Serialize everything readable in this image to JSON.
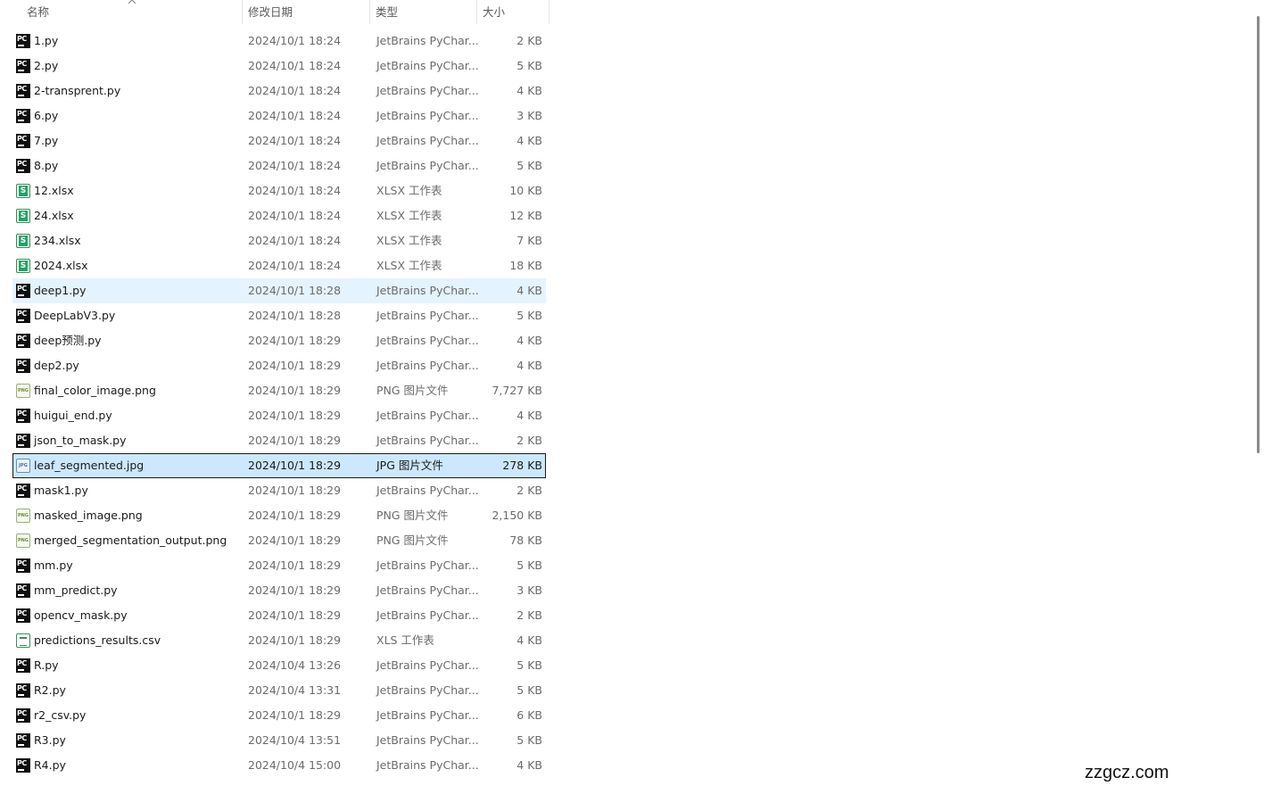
{
  "columns": {
    "name": "名称",
    "date": "修改日期",
    "type": "类型",
    "size": "大小"
  },
  "files": [
    {
      "name": "1.py",
      "date": "2024/10/1 18:24",
      "type": "JetBrains PyChar...",
      "size": "2 KB",
      "icon": "pycharm-icon"
    },
    {
      "name": "2.py",
      "date": "2024/10/1 18:24",
      "type": "JetBrains PyChar...",
      "size": "5 KB",
      "icon": "pycharm-icon"
    },
    {
      "name": "2-transprent.py",
      "date": "2024/10/1 18:24",
      "type": "JetBrains PyChar...",
      "size": "4 KB",
      "icon": "pycharm-icon"
    },
    {
      "name": "6.py",
      "date": "2024/10/1 18:24",
      "type": "JetBrains PyChar...",
      "size": "3 KB",
      "icon": "pycharm-icon"
    },
    {
      "name": "7.py",
      "date": "2024/10/1 18:24",
      "type": "JetBrains PyChar...",
      "size": "4 KB",
      "icon": "pycharm-icon"
    },
    {
      "name": "8.py",
      "date": "2024/10/1 18:24",
      "type": "JetBrains PyChar...",
      "size": "5 KB",
      "icon": "pycharm-icon"
    },
    {
      "name": "12.xlsx",
      "date": "2024/10/1 18:24",
      "type": "XLSX 工作表",
      "size": "10 KB",
      "icon": "spreadsheet-icon"
    },
    {
      "name": "24.xlsx",
      "date": "2024/10/1 18:24",
      "type": "XLSX 工作表",
      "size": "12 KB",
      "icon": "spreadsheet-icon"
    },
    {
      "name": "234.xlsx",
      "date": "2024/10/1 18:24",
      "type": "XLSX 工作表",
      "size": "7 KB",
      "icon": "spreadsheet-icon"
    },
    {
      "name": "2024.xlsx",
      "date": "2024/10/1 18:24",
      "type": "XLSX 工作表",
      "size": "18 KB",
      "icon": "spreadsheet-icon"
    },
    {
      "name": "deep1.py",
      "date": "2024/10/1 18:28",
      "type": "JetBrains PyChar...",
      "size": "4 KB",
      "icon": "pycharm-icon",
      "state": "hover"
    },
    {
      "name": "DeepLabV3.py",
      "date": "2024/10/1 18:28",
      "type": "JetBrains PyChar...",
      "size": "5 KB",
      "icon": "pycharm-icon"
    },
    {
      "name": "deep预测.py",
      "date": "2024/10/1 18:29",
      "type": "JetBrains PyChar...",
      "size": "4 KB",
      "icon": "pycharm-icon"
    },
    {
      "name": "dep2.py",
      "date": "2024/10/1 18:29",
      "type": "JetBrains PyChar...",
      "size": "4 KB",
      "icon": "pycharm-icon"
    },
    {
      "name": "final_color_image.png",
      "date": "2024/10/1 18:29",
      "type": "PNG 图片文件",
      "size": "7,727 KB",
      "icon": "png-icon"
    },
    {
      "name": "huigui_end.py",
      "date": "2024/10/1 18:29",
      "type": "JetBrains PyChar...",
      "size": "4 KB",
      "icon": "pycharm-icon"
    },
    {
      "name": "json_to_mask.py",
      "date": "2024/10/1 18:29",
      "type": "JetBrains PyChar...",
      "size": "2 KB",
      "icon": "pycharm-icon"
    },
    {
      "name": "leaf_segmented.jpg",
      "date": "2024/10/1 18:29",
      "type": "JPG 图片文件",
      "size": "278 KB",
      "icon": "jpg-icon",
      "state": "selected"
    },
    {
      "name": "mask1.py",
      "date": "2024/10/1 18:29",
      "type": "JetBrains PyChar...",
      "size": "2 KB",
      "icon": "pycharm-icon"
    },
    {
      "name": "masked_image.png",
      "date": "2024/10/1 18:29",
      "type": "PNG 图片文件",
      "size": "2,150 KB",
      "icon": "png-icon"
    },
    {
      "name": "merged_segmentation_output.png",
      "date": "2024/10/1 18:29",
      "type": "PNG 图片文件",
      "size": "78 KB",
      "icon": "png-icon"
    },
    {
      "name": "mm.py",
      "date": "2024/10/1 18:29",
      "type": "JetBrains PyChar...",
      "size": "5 KB",
      "icon": "pycharm-icon"
    },
    {
      "name": "mm_predict.py",
      "date": "2024/10/1 18:29",
      "type": "JetBrains PyChar...",
      "size": "3 KB",
      "icon": "pycharm-icon"
    },
    {
      "name": "opencv_mask.py",
      "date": "2024/10/1 18:29",
      "type": "JetBrains PyChar...",
      "size": "2 KB",
      "icon": "pycharm-icon"
    },
    {
      "name": "predictions_results.csv",
      "date": "2024/10/1 18:29",
      "type": "XLS 工作表",
      "size": "4 KB",
      "icon": "csv-icon"
    },
    {
      "name": "R.py",
      "date": "2024/10/4 13:26",
      "type": "JetBrains PyChar...",
      "size": "5 KB",
      "icon": "pycharm-icon"
    },
    {
      "name": "R2.py",
      "date": "2024/10/4 13:31",
      "type": "JetBrains PyChar...",
      "size": "5 KB",
      "icon": "pycharm-icon"
    },
    {
      "name": "r2_csv.py",
      "date": "2024/10/1 18:29",
      "type": "JetBrains PyChar...",
      "size": "6 KB",
      "icon": "pycharm-icon"
    },
    {
      "name": "R3.py",
      "date": "2024/10/4 13:51",
      "type": "JetBrains PyChar...",
      "size": "5 KB",
      "icon": "pycharm-icon"
    },
    {
      "name": "R4.py",
      "date": "2024/10/4 15:00",
      "type": "JetBrains PyChar...",
      "size": "4 KB",
      "icon": "pycharm-icon"
    }
  ],
  "watermark": "zzgcz.com"
}
